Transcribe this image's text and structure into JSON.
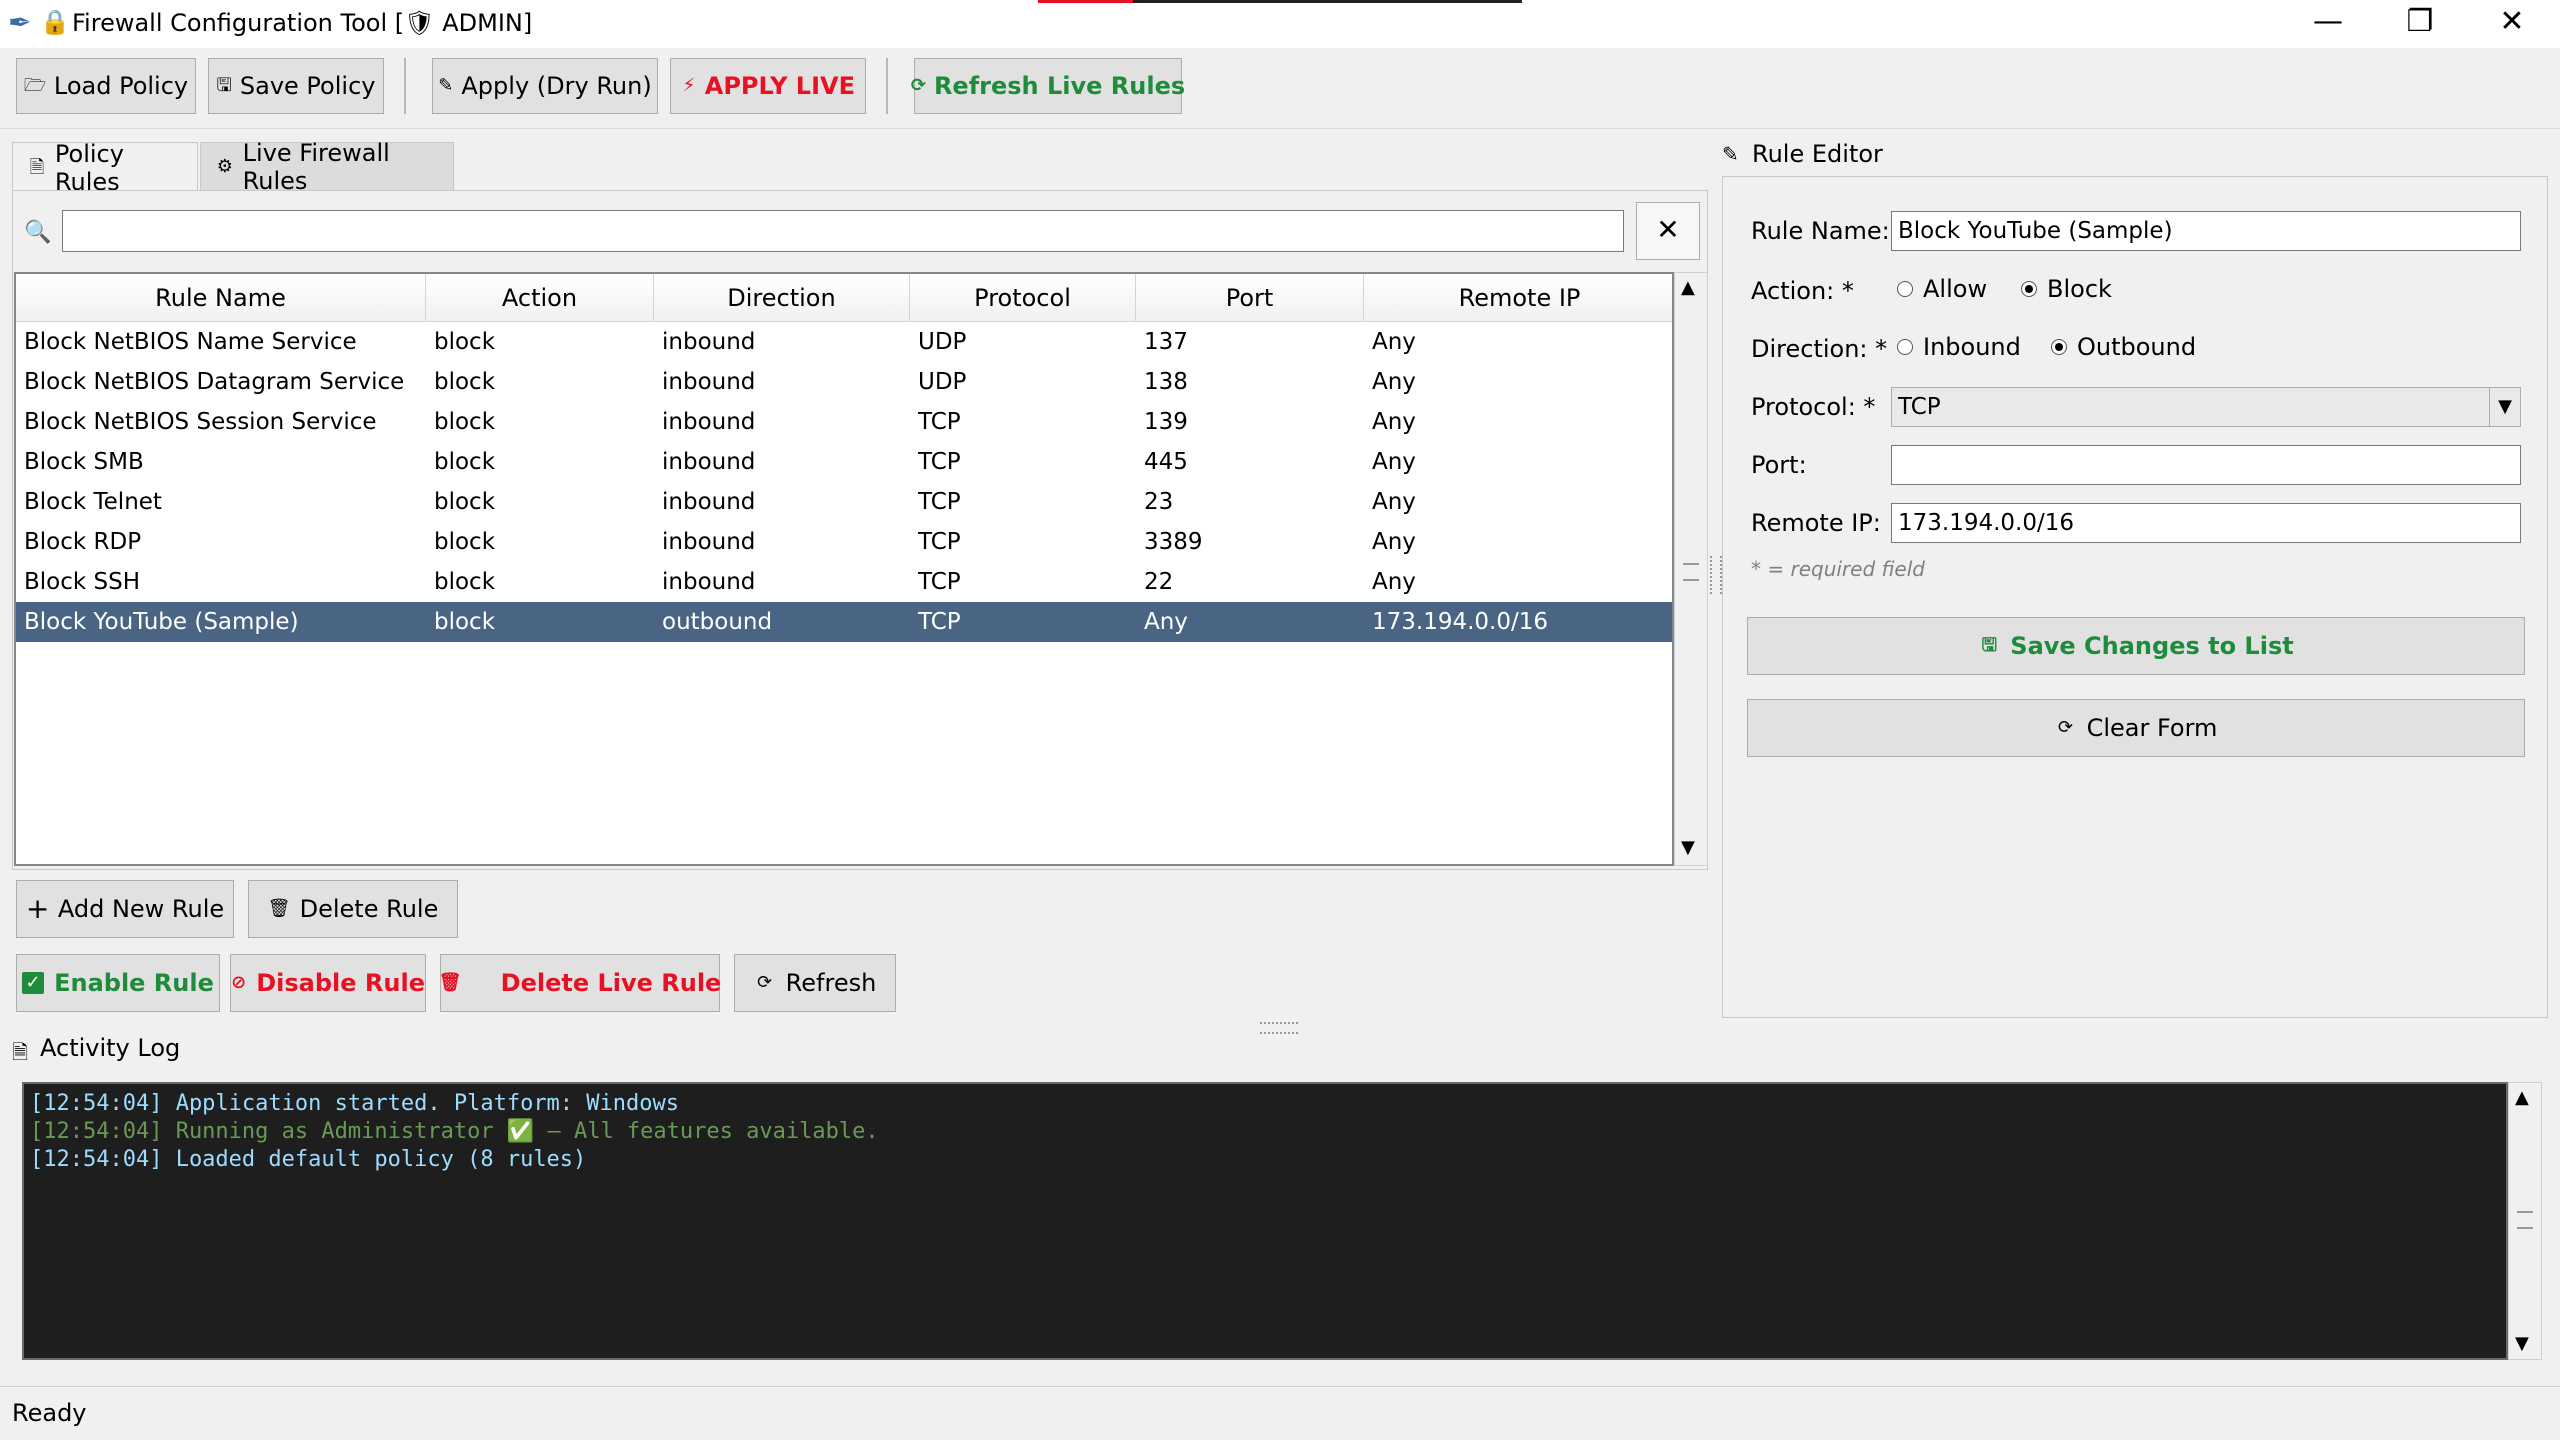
{
  "window": {
    "title": "Firewall Configuration Tool  [🛡 ADMIN]",
    "minimize": "—",
    "restore": "❐",
    "close": "✕"
  },
  "toolbar": {
    "load": "Load Policy",
    "save": "Save Policy",
    "dry_run": "Apply (Dry Run)",
    "apply_live": "APPLY LIVE",
    "refresh_live": "Refresh Live Rules",
    "colors": {
      "danger": "#e81123",
      "success": "#1e8c3a"
    }
  },
  "tabs": [
    {
      "label": "Policy Rules",
      "icon": "document-icon"
    },
    {
      "label": "Live Firewall Rules",
      "icon": "gear-icon"
    }
  ],
  "search": {
    "value": "",
    "placeholder": "",
    "clear": "✕"
  },
  "table": {
    "columns": [
      "Rule Name",
      "Action",
      "Direction",
      "Protocol",
      "Port",
      "Remote IP"
    ],
    "rows": [
      [
        "Block NetBIOS Name Service",
        "block",
        "inbound",
        "UDP",
        "137",
        "Any"
      ],
      [
        "Block NetBIOS Datagram Service",
        "block",
        "inbound",
        "UDP",
        "138",
        "Any"
      ],
      [
        "Block NetBIOS Session Service",
        "block",
        "inbound",
        "TCP",
        "139",
        "Any"
      ],
      [
        "Block SMB",
        "block",
        "inbound",
        "TCP",
        "445",
        "Any"
      ],
      [
        "Block Telnet",
        "block",
        "inbound",
        "TCP",
        "23",
        "Any"
      ],
      [
        "Block RDP",
        "block",
        "inbound",
        "TCP",
        "3389",
        "Any"
      ],
      [
        "Block SSH",
        "block",
        "inbound",
        "TCP",
        "22",
        "Any"
      ],
      [
        "Block YouTube (Sample)",
        "block",
        "outbound",
        "TCP",
        "Any",
        "173.194.0.0/16"
      ]
    ],
    "selected_row": 7
  },
  "rule_actions": {
    "add": "Add New Rule",
    "delete": "Delete Rule",
    "enable": "Enable Rule",
    "disable": "Disable Rule",
    "delete_live": "Delete Live Rule",
    "refresh": "Refresh"
  },
  "editor": {
    "title": "Rule Editor",
    "name_label": "Rule Name: *",
    "name_value": "Block YouTube (Sample)",
    "action_label": "Action: *",
    "action_options": [
      "Allow",
      "Block"
    ],
    "action_selected": "Block",
    "direction_label": "Direction: *",
    "direction_options": [
      "Inbound",
      "Outbound"
    ],
    "direction_selected": "Outbound",
    "protocol_label": "Protocol: *",
    "protocol_value": "TCP",
    "port_label": "Port:",
    "port_value": "",
    "remote_label": "Remote IP:",
    "remote_value": "173.194.0.0/16",
    "required_note": "* = required field",
    "save": "Save Changes to List",
    "clear": "Clear Form"
  },
  "log": {
    "title": "Activity Log",
    "lines": [
      {
        "text": "[12:54:04] Application started. Platform: Windows",
        "color": "#9cdcfe"
      },
      {
        "text": "[12:54:04] Running as Administrator ✅ — All features available.",
        "color": "#6a9955"
      },
      {
        "text": "[12:54:04] Loaded default policy (8 rules)",
        "color": "#9cdcfe"
      }
    ]
  },
  "status": "Ready"
}
